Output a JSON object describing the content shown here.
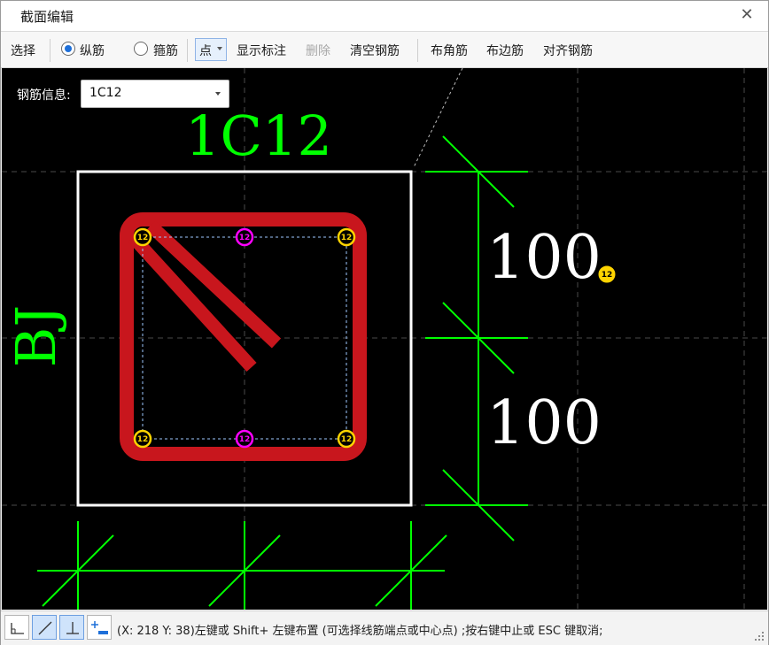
{
  "window": {
    "title": "截面编辑"
  },
  "toolbar": {
    "select": "选择",
    "longitudinal": "纵筋",
    "stirrup": "箍筋",
    "mode": "点",
    "show_annotation": "显示标注",
    "delete": "删除",
    "clear": "清空钢筋",
    "corner": "布角筋",
    "edge": "布边筋",
    "align": "对齐钢筋"
  },
  "rebar_info": {
    "label": "钢筋信息:",
    "value": "1C12"
  },
  "drawing": {
    "rebar_label": "1C12",
    "side_label": "BJ",
    "dim_top": "100",
    "dim_bottom": "100",
    "bar_size": "12",
    "colors": {
      "background": "#000000",
      "dimension": "#00ff00",
      "stirrup": "#c8161d",
      "outline": "#ffffff",
      "corner_bar": "#ffd400",
      "mid_bar": "#ff00ff"
    }
  },
  "status": {
    "text": "(X: 218 Y: 38)左键或 Shift+ 左键布置 (可选择线筋端点或中心点) ;按右键中止或 ESC 键取消;"
  }
}
